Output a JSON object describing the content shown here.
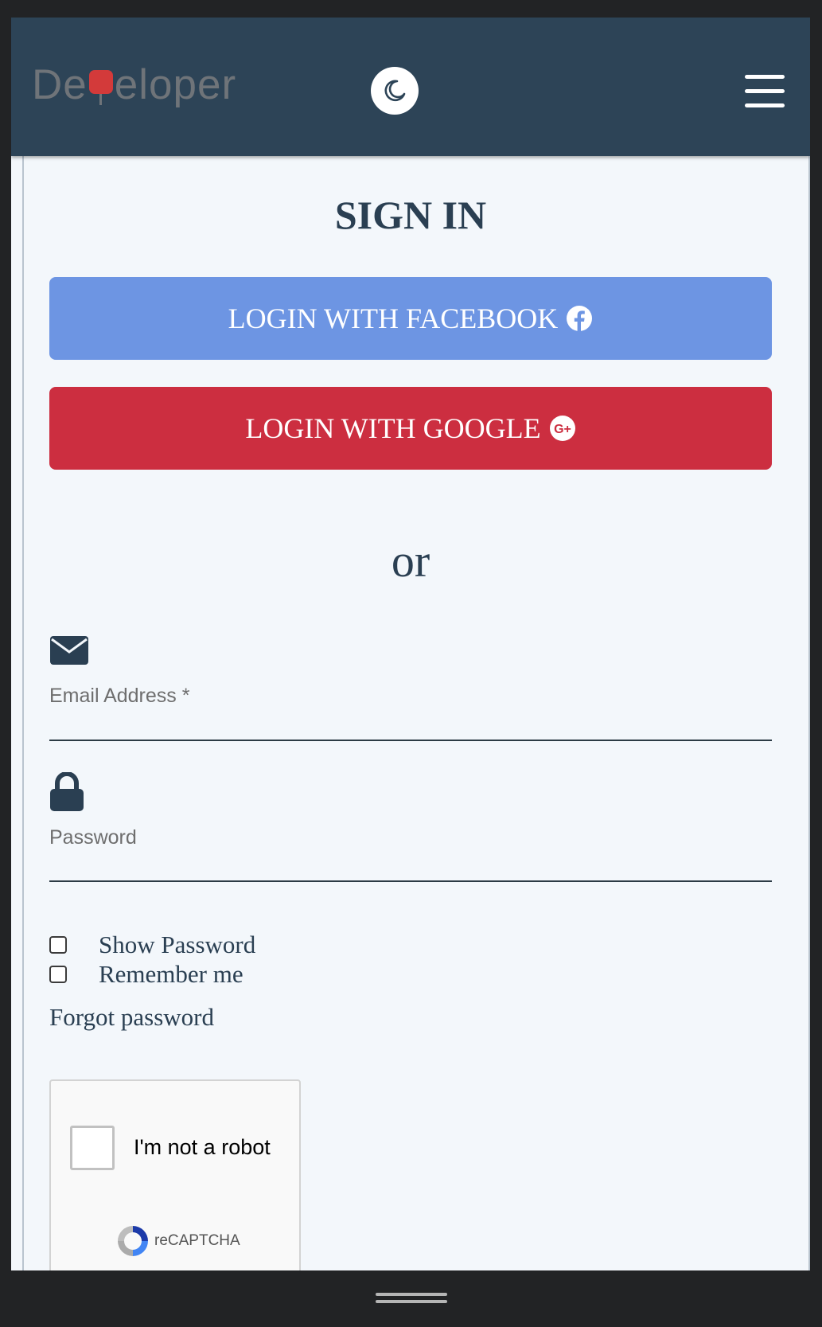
{
  "header": {
    "brand_prefix": "De",
    "brand_suffix": "eloper",
    "theme_toggle_icon": "moon-icon",
    "menu_icon": "hamburger-icon"
  },
  "signin": {
    "title": "SIGN IN",
    "facebook_label": "LOGIN WITH FACEBOOK",
    "facebook_icon": "facebook-icon",
    "facebook_color": "#6d95e3",
    "google_label": "LOGIN WITH GOOGLE",
    "google_icon": "google-plus-icon",
    "google_color": "#cc2e40",
    "separator": "or"
  },
  "form": {
    "email": {
      "icon": "envelope-icon",
      "label": "Email Address *",
      "value": ""
    },
    "password": {
      "icon": "lock-icon",
      "label": "Password",
      "value": ""
    },
    "show_password": {
      "label": "Show Password",
      "checked": false
    },
    "remember_me": {
      "label": "Remember me",
      "checked": false
    },
    "forgot_password": "Forgot password"
  },
  "recaptcha": {
    "checkbox_label": "I'm not a robot",
    "brand": "reCAPTCHA"
  },
  "colors": {
    "navbar": "#2d4457",
    "text_dark": "#2a3f52",
    "page_background": "#f3f7fb"
  }
}
